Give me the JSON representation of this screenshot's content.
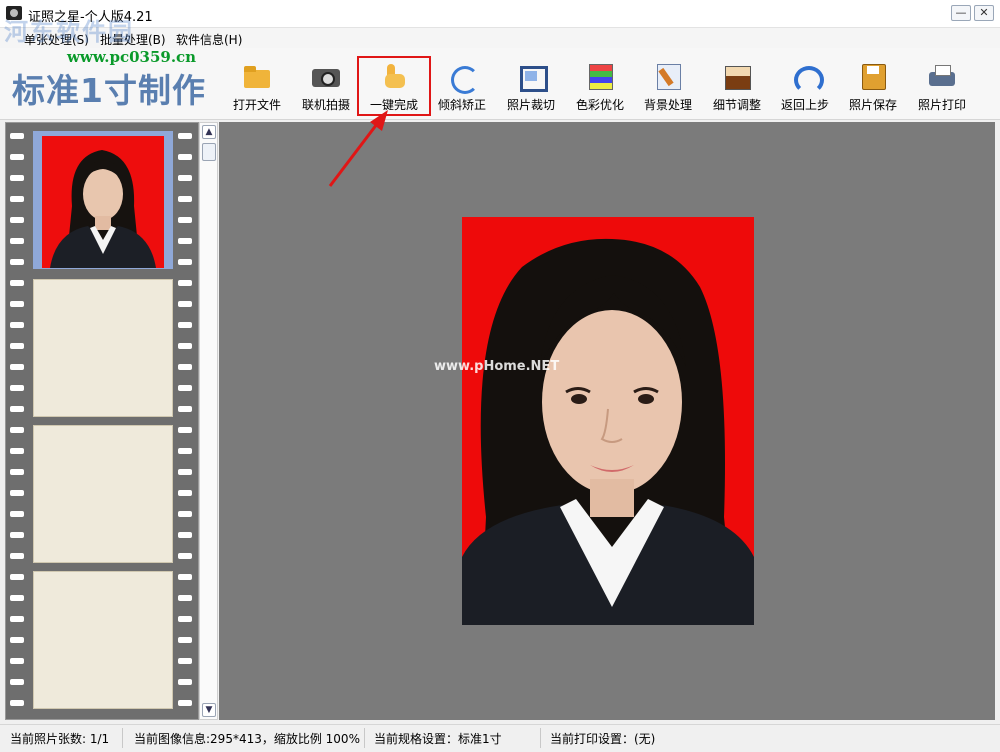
{
  "window": {
    "title": "证照之星-个人版4.21",
    "minimize_glyph": "—",
    "close_glyph": "✕"
  },
  "watermark": {
    "site_name": "河东软件园",
    "site_url": "www.pc0359.cn",
    "photo_watermark": "www.pHome.NET"
  },
  "menu": {
    "items": [
      "单张处理(S)",
      "批量处理(B)",
      "软件信息(H)"
    ]
  },
  "toolbar": {
    "brand": "标准1寸制作",
    "tools": [
      {
        "label": "打开文件",
        "icon": "folder-icon"
      },
      {
        "label": "联机拍摄",
        "icon": "camera-icon"
      },
      {
        "label": "一键完成",
        "icon": "hand-icon"
      },
      {
        "label": "倾斜矫正",
        "icon": "rotate-icon"
      },
      {
        "label": "照片裁切",
        "icon": "crop-icon"
      },
      {
        "label": "色彩优化",
        "icon": "color-icon"
      },
      {
        "label": "背景处理",
        "icon": "background-icon"
      },
      {
        "label": "细节调整",
        "icon": "detail-icon"
      },
      {
        "label": "返回上步",
        "icon": "undo-icon"
      },
      {
        "label": "照片保存",
        "icon": "save-icon"
      },
      {
        "label": "照片打印",
        "icon": "print-icon"
      }
    ],
    "highlighted": "一键完成"
  },
  "colors": {
    "photo_background": "#ee0a0a",
    "canvas": "#7b7b7b",
    "highlight_box": "#e01616",
    "brand_text": "#5a7fb0"
  },
  "statusbar": {
    "photo_count": "当前照片张数: 1/1",
    "image_info": "当前图像信息:295*413，缩放比例 100%",
    "spec": "当前规格设置：标准1寸",
    "print": "当前打印设置：(无)"
  }
}
